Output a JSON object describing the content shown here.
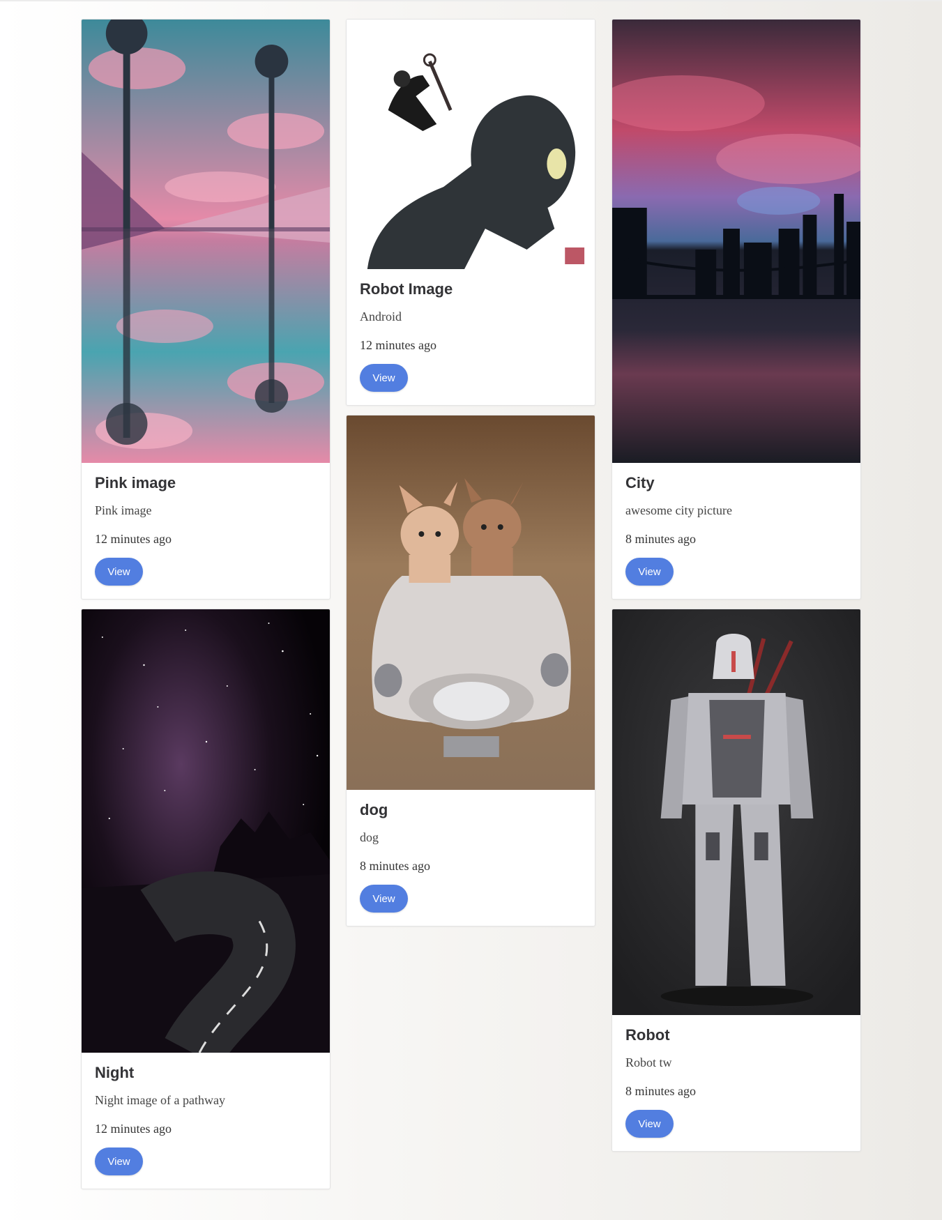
{
  "cards": [
    {
      "title": "Pink image",
      "description": "Pink image",
      "time": "12 minutes ago",
      "button": "View"
    },
    {
      "title": "Night",
      "description": "Night image of a pathway",
      "time": "12 minutes ago",
      "button": "View"
    },
    {
      "title": "Robot Image",
      "description": "Android",
      "time": "12 minutes ago",
      "button": "View"
    },
    {
      "title": "dog",
      "description": "dog",
      "time": "8 minutes ago",
      "button": "View"
    },
    {
      "title": "City",
      "description": "awesome city picture",
      "time": "8 minutes ago",
      "button": "View"
    },
    {
      "title": "Robot",
      "description": "Robot tw",
      "time": "8 minutes ago",
      "button": "View"
    }
  ],
  "colors": {
    "button": "#527ee0",
    "card_border": "#e3e3e3"
  }
}
